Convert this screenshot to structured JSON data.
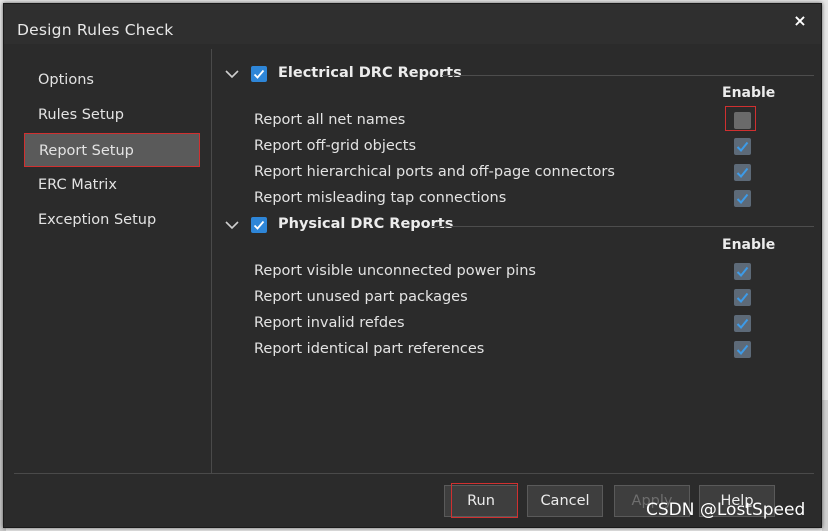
{
  "dialog": {
    "title": "Design Rules Check",
    "close_glyph": "×"
  },
  "sidebar": {
    "items": [
      {
        "label": "Options"
      },
      {
        "label": "Rules Setup"
      },
      {
        "label": "Report Setup",
        "active": true
      },
      {
        "label": "ERC Matrix"
      },
      {
        "label": "Exception Setup"
      }
    ]
  },
  "electrical": {
    "title": "Electrical DRC Reports",
    "checked": true,
    "enable_label": "Enable",
    "rows": [
      {
        "label": "Report all net names",
        "checked": false
      },
      {
        "label": "Report off-grid objects",
        "checked": true
      },
      {
        "label": "Report hierarchical ports and off-page connectors",
        "checked": true
      },
      {
        "label": "Report misleading tap connections",
        "checked": true
      }
    ]
  },
  "physical": {
    "title": "Physical DRC Reports",
    "checked": true,
    "enable_label": "Enable",
    "rows": [
      {
        "label": "Report visible unconnected power pins",
        "checked": true
      },
      {
        "label": "Report unused part packages",
        "checked": true
      },
      {
        "label": "Report invalid refdes",
        "checked": true
      },
      {
        "label": "Report identical part references",
        "checked": true
      }
    ]
  },
  "footer": {
    "run_label": "Run",
    "cancel_label": "Cancel",
    "apply_label": "Apply",
    "help_label": "Help"
  },
  "watermark": "CSDN @LostSpeed",
  "colors": {
    "accent": "#2e86d8",
    "highlight": "#d03030",
    "background": "#2b2b2b"
  }
}
